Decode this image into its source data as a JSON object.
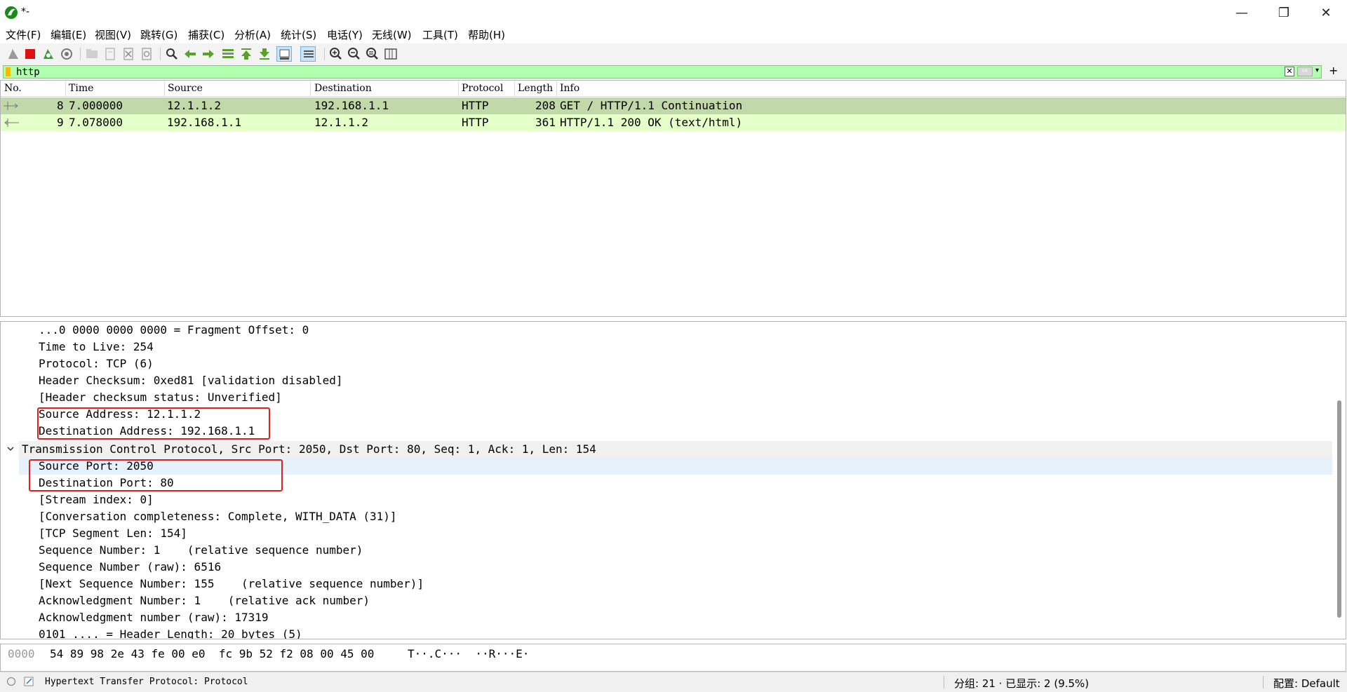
{
  "window": {
    "title": "*-",
    "minimize_glyph": "—",
    "restore_glyph": "❐",
    "close_glyph": "✕"
  },
  "menu": [
    "文件(F)",
    "编辑(E)",
    "视图(V)",
    "跳转(G)",
    "捕获(C)",
    "分析(A)",
    "统计(S)",
    "电话(Y)",
    "无线(W)",
    "工具(T)",
    "帮助(H)"
  ],
  "toolbar": {
    "icons": [
      "shark-fin-start-icon",
      "stop-capture-icon",
      "restart-capture-icon",
      "capture-options-icon",
      "open-file-icon",
      "save-file-icon",
      "close-file-icon",
      "reload-file-icon",
      "find-packet-icon",
      "go-back-icon",
      "go-forward-icon",
      "go-to-packet-icon",
      "go-first-icon",
      "go-last-icon",
      "autoscroll-icon",
      "colorize-icon",
      "zoom-in-icon",
      "zoom-out-icon",
      "normal-size-icon",
      "resize-columns-icon"
    ]
  },
  "filter": {
    "value": "http",
    "clear_glyph": "✕",
    "apply_glyph": "⇨",
    "dropdown_glyph": "▾",
    "add_glyph": "+"
  },
  "packet_list": {
    "columns": [
      "No.",
      "Time",
      "Source",
      "Destination",
      "Protocol",
      "Length",
      "Info"
    ],
    "rows": [
      {
        "no": "8",
        "time": "7.000000",
        "source": "12.1.1.2",
        "destination": "192.168.1.1",
        "protocol": "HTTP",
        "length": "208",
        "info": "GET / HTTP/1.1 Continuation"
      },
      {
        "no": "9",
        "time": "7.078000",
        "source": "192.168.1.1",
        "destination": "12.1.1.2",
        "protocol": "HTTP",
        "length": "361",
        "info": "HTTP/1.1 200 OK  (text/html)"
      }
    ]
  },
  "details": {
    "lines": [
      "...0 0000 0000 0000 = Fragment Offset: 0",
      "Time to Live: 254",
      "Protocol: TCP (6)",
      "Header Checksum: 0xed81 [validation disabled]",
      "[Header checksum status: Unverified]",
      "Source Address: 12.1.1.2",
      "Destination Address: 192.168.1.1",
      "Transmission Control Protocol, Src Port: 2050, Dst Port: 80, Seq: 1, Ack: 1, Len: 154",
      "Source Port: 2050",
      "Destination Port: 80",
      "[Stream index: 0]",
      "[Conversation completeness: Complete, WITH_DATA (31)]",
      "[TCP Segment Len: 154]",
      "Sequence Number: 1    (relative sequence number)",
      "Sequence Number (raw): 6516",
      "[Next Sequence Number: 155    (relative sequence number)]",
      "Acknowledgment Number: 1    (relative ack number)",
      "Acknowledgment number (raw): 17319",
      "0101 .... = Header Length: 20 bytes (5)"
    ]
  },
  "bytes": {
    "offset": "0000",
    "hex": "54 89 98 2e 43 fe 00 e0  fc 9b 52 f2 08 00 45 00",
    "ascii": "T··.C···  ··R···E·"
  },
  "status": {
    "text": "Hypertext Transfer Protocol: Protocol",
    "counts": "分组: 21 · 已显示: 2 (9.5%)",
    "profile": "配置: Default"
  },
  "colors": {
    "row_selected": "#c1d8a9",
    "row_http": "#e4ffc7",
    "filter_valid": "#afffaf",
    "highlight_box": "#e02020"
  }
}
